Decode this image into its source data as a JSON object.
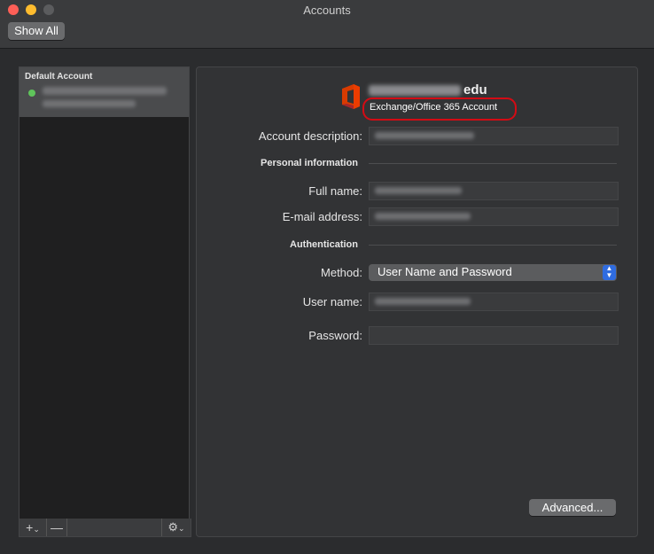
{
  "window": {
    "title": "Accounts",
    "show_all_label": "Show All"
  },
  "sidebar": {
    "section_label": "Default Account",
    "status_color": "#5fc45b",
    "toolbar": {
      "add_glyph": "+",
      "remove_glyph": "—",
      "chevron": "⌄",
      "gear_glyph": "⚙"
    }
  },
  "account": {
    "title_suffix": "edu",
    "type": "Exchange/Office 365 Account"
  },
  "form": {
    "account_description_label": "Account description:",
    "personal_info_heading": "Personal information",
    "full_name_label": "Full name:",
    "email_label": "E-mail address:",
    "authentication_heading": "Authentication",
    "method_label": "Method:",
    "method_value": "User Name and Password",
    "username_label": "User name:",
    "password_label": "Password:",
    "password_value": ""
  },
  "buttons": {
    "advanced_label": "Advanced..."
  },
  "colors": {
    "highlight": "#d40b14",
    "accent": "#2f6ce0"
  }
}
